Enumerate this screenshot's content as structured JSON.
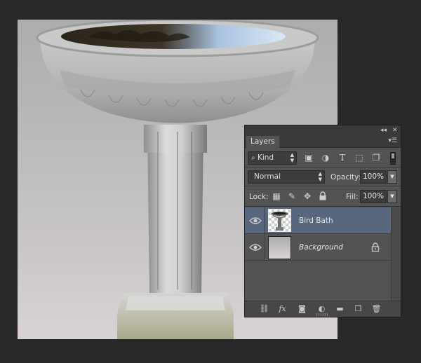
{
  "panel": {
    "tab_label": "Layers",
    "collapse_icon": "double-chevron-left-icon",
    "close_icon": "close-icon",
    "menu_icon": "panel-menu-icon",
    "filter": {
      "kind_label": "Kind",
      "icons": [
        "image-filter-icon",
        "adjustment-filter-icon",
        "type-filter-icon",
        "shape-filter-icon",
        "smart-object-filter-icon"
      ]
    },
    "blend_mode": "Normal",
    "opacity_label": "Opacity:",
    "opacity_value": "100%",
    "lock_label": "Lock:",
    "fill_label": "Fill:",
    "fill_value": "100%",
    "layers": [
      {
        "name": "Bird Bath",
        "selected": true,
        "visible": true,
        "locked": false
      },
      {
        "name": "Background",
        "selected": false,
        "visible": true,
        "locked": true
      }
    ],
    "bottom_icons": [
      "link-layers-icon",
      "fx-icon",
      "layer-mask-icon",
      "adjustment-layer-icon",
      "new-group-icon",
      "new-layer-icon",
      "trash-icon"
    ],
    "fx_label": "fx"
  },
  "colors": {
    "workspace": "#282828",
    "panel_bg": "#535353",
    "selected_layer": "#59677e"
  }
}
